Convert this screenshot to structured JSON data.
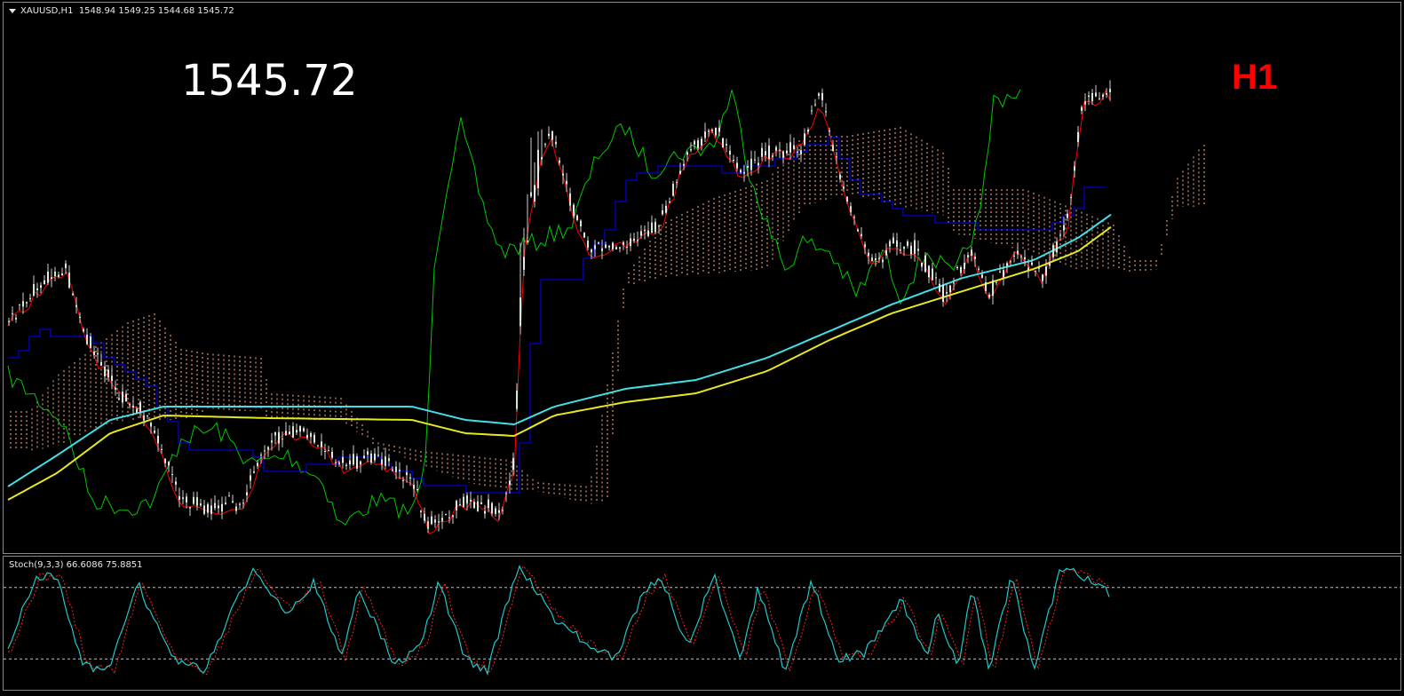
{
  "header": {
    "symbol": "XAUUSD,H1",
    "ohlc": "1548.94 1549.25 1544.68 1545.72",
    "dropdown_icon": "triangle-down-icon"
  },
  "overlay": {
    "price": "1545.72",
    "timeframe": "H1",
    "timeframe_color": "#ff0000"
  },
  "stochastic": {
    "label": "Stoch(9,3,3) 66.6086 75.8851",
    "levels": [
      80,
      20
    ],
    "main_color": "#20c8c8",
    "signal_color": "#ff2020"
  },
  "colors": {
    "background": "#000000",
    "bull_candle": "#e8e8e8",
    "bear_candle": "#cfe8cf",
    "tenkan": "#ff0000",
    "kijun": "#0000ff",
    "chikou": "#00c800",
    "cloud": "#ffb080",
    "ma_fast": "#40e0e8",
    "ma_slow": "#e8e820",
    "grid": "#c0c0c0"
  }
}
